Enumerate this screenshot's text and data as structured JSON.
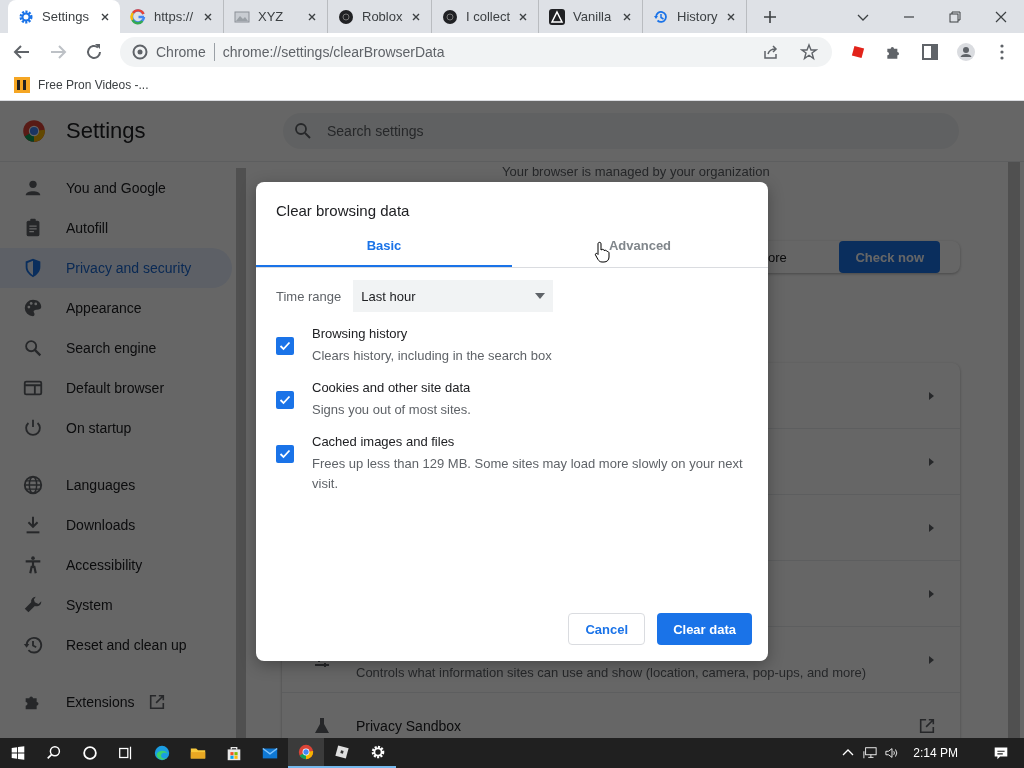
{
  "browser": {
    "tabs": [
      {
        "title": "Settings",
        "selected": true
      },
      {
        "title": "https://",
        "selected": false
      },
      {
        "title": "XYZ",
        "selected": false
      },
      {
        "title": "Roblox",
        "selected": false
      },
      {
        "title": "I collect",
        "selected": false
      },
      {
        "title": "Vanilla",
        "selected": false
      },
      {
        "title": "History",
        "selected": false
      }
    ],
    "address": {
      "site_label": "Chrome",
      "url": "chrome://settings/clearBrowserData"
    },
    "bookmarks": [
      {
        "label": "Free Pron Videos -..."
      }
    ]
  },
  "settings": {
    "title": "Settings",
    "search": {
      "placeholder": "Search settings"
    },
    "nav_sections": [
      {
        "items": [
          {
            "label": "You and Google",
            "selected": false
          },
          {
            "label": "Autofill",
            "selected": false
          },
          {
            "label": "Privacy and security",
            "selected": true
          },
          {
            "label": "Appearance",
            "selected": false
          },
          {
            "label": "Search engine",
            "selected": false
          },
          {
            "label": "Default browser",
            "selected": false
          },
          {
            "label": "On startup",
            "selected": false
          }
        ]
      },
      {
        "items": [
          {
            "label": "Languages",
            "selected": false
          },
          {
            "label": "Downloads",
            "selected": false
          },
          {
            "label": "Accessibility",
            "selected": false
          },
          {
            "label": "System",
            "selected": false
          },
          {
            "label": "Reset and clean up",
            "selected": false
          }
        ]
      },
      {
        "items": [
          {
            "label": "Extensions",
            "selected": false,
            "external": true
          }
        ]
      }
    ],
    "managed_notice": "Your browser is managed by your organization",
    "safety_card": {
      "text": "ore",
      "button": "Check now"
    },
    "privacy_rows": [
      {
        "kind": "arrow"
      },
      {
        "kind": "arrow"
      },
      {
        "kind": "arrow"
      },
      {
        "kind": "arrow"
      },
      {
        "kind": "arrow",
        "subtitle": "Controls what information sites can use and show (location, camera, pop-ups, and more)"
      },
      {
        "kind": "external",
        "title": "Privacy Sandbox"
      }
    ]
  },
  "dialog": {
    "title": "Clear browsing data",
    "tabs": [
      {
        "label": "Basic",
        "selected": true
      },
      {
        "label": "Advanced",
        "selected": false
      }
    ],
    "time_range": {
      "label": "Time range",
      "value": "Last hour"
    },
    "options": [
      {
        "label": "Browsing history",
        "description": "Clears history, including in the search box",
        "checked": true
      },
      {
        "label": "Cookies and other site data",
        "description": "Signs you out of most sites.",
        "checked": true
      },
      {
        "label": "Cached images and files",
        "description": "Frees up less than 129 MB. Some sites may load more slowly on your next visit.",
        "checked": true
      }
    ],
    "buttons": [
      {
        "label": "Cancel",
        "kind": "secondary"
      },
      {
        "label": "Clear data",
        "kind": "primary"
      }
    ]
  },
  "taskbar": {
    "apps": [
      {
        "active": false,
        "running": false
      },
      {
        "active": false,
        "running": false
      },
      {
        "active": false,
        "running": false
      },
      {
        "active": false,
        "running": false
      },
      {
        "active": true,
        "running": true
      },
      {
        "active": false,
        "running": true
      },
      {
        "active": false,
        "running": true
      }
    ],
    "time": "2:14 PM"
  }
}
